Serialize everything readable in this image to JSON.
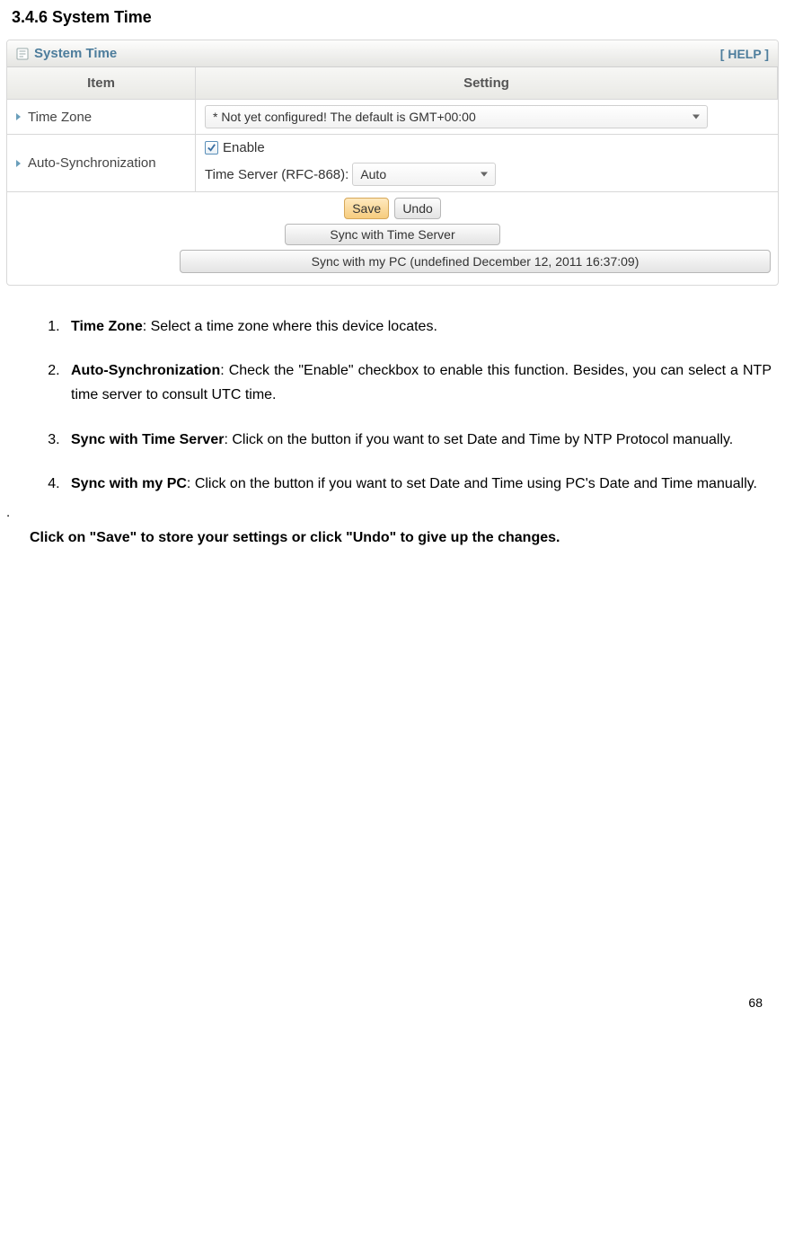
{
  "section_title": "3.4.6 System Time",
  "panel": {
    "title": "System Time",
    "help": "[ HELP ]",
    "columns": {
      "item": "Item",
      "setting": "Setting"
    },
    "rows": {
      "timezone": {
        "label": "Time Zone",
        "value": "* Not yet configured! The default is GMT+00:00"
      },
      "autosync": {
        "label": "Auto-Synchronization",
        "enable_label": "Enable",
        "server_label": "Time Server (RFC-868):",
        "server_value": "Auto"
      }
    },
    "buttons": {
      "save": "Save",
      "undo": "Undo",
      "sync_server": "Sync with Time Server",
      "sync_pc": "Sync with my PC (undefined December 12, 2011 16:37:09)"
    }
  },
  "instructions": [
    {
      "bold": "Time Zone",
      "rest": ": Select a time zone where this device locates."
    },
    {
      "bold": "Auto-Synchronization",
      "rest": ": Check the \"Enable\" checkbox to enable this function. Besides, you can select a NTP time server to consult UTC time."
    },
    {
      "bold": "Sync with Time Server",
      "rest": ": Click on the button if you want to set Date and Time by NTP Protocol manually."
    },
    {
      "bold": "Sync with my PC",
      "rest": ": Click on the button if you want to set Date and Time using PC's Date and Time manually."
    }
  ],
  "dot": ".",
  "closing": "Click on \"Save\" to store your settings or click \"Undo\" to give up the changes.",
  "page_number": "68"
}
